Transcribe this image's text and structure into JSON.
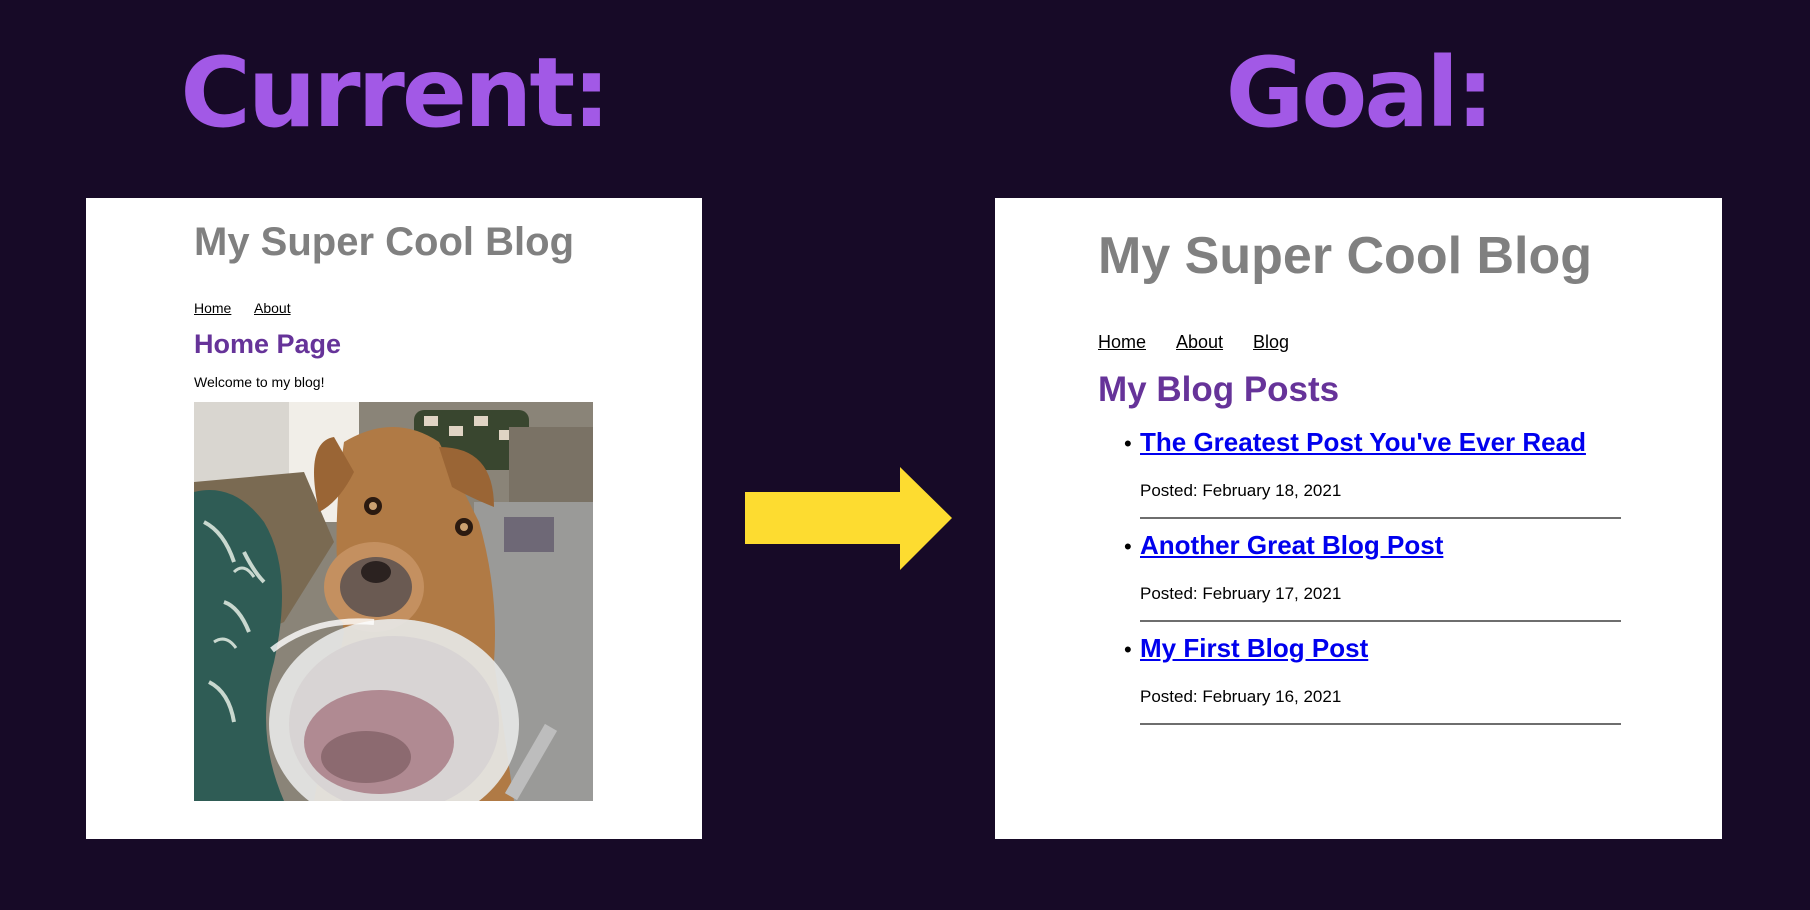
{
  "headings": {
    "current": "Current:",
    "goal": "Goal:"
  },
  "current_panel": {
    "blog_title": "My Super Cool Blog",
    "nav": [
      "Home",
      "About"
    ],
    "page_heading": "Home Page",
    "welcome_text": "Welcome to my blog!"
  },
  "goal_panel": {
    "blog_title": "My Super Cool Blog",
    "nav": [
      "Home",
      "About",
      "Blog"
    ],
    "page_heading": "My Blog Posts",
    "posts": [
      {
        "title": "The Greatest Post You've Ever Read",
        "date": "Posted: February 18, 2021"
      },
      {
        "title": "Another Great Blog Post",
        "date": "Posted: February 17, 2021"
      },
      {
        "title": "My First Blog Post",
        "date": "Posted: February 16, 2021"
      }
    ]
  },
  "colors": {
    "background": "#170a27",
    "heading": "#a259e6",
    "arrow": "#fddc30",
    "blog_title": "#808080",
    "page_heading": "#663399",
    "post_link": "#0000ee"
  },
  "icons": {
    "arrow": "right-arrow-icon",
    "photo": "dog-photo"
  }
}
